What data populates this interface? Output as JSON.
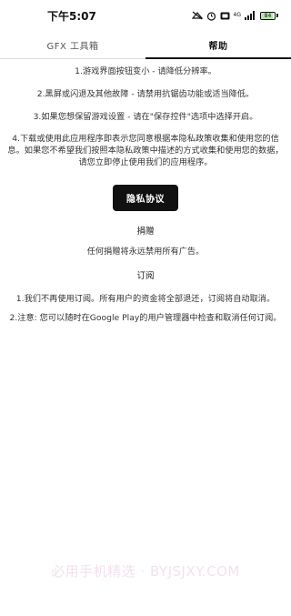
{
  "status_bar": {
    "time": "下午5:07",
    "network_label": "4G",
    "battery_level": "84",
    "icons": [
      "do-not-disturb-icon",
      "alarm-icon",
      "hd-icon",
      "signal-icon",
      "battery-icon"
    ]
  },
  "tabs": [
    {
      "label": "GFX 工具箱",
      "active": false
    },
    {
      "label": "帮助",
      "active": true
    }
  ],
  "help": {
    "p1": "1.游戏界面按钮变小 - 请降低分辨率。",
    "p2": "2.黑屏或闪退及其他故障 - 请禁用抗锯齿功能或适当降低。",
    "p3": "3.如果您想保留游戏设置 - 请在\"保存控件\"选项中选择开启。",
    "p4": "4.下载或使用此应用程序即表示您同意根据本隐私政策收集和使用您的信息。如果您不希望我们按照本隐私政策中描述的方式收集和使用您的数据，请您立即停止使用我们的应用程序。"
  },
  "privacy_button_label": "隐私协议",
  "donation": {
    "title": "捐赠",
    "text": "任何捐赠将永远禁用所有广告。"
  },
  "subscription": {
    "title": "订阅",
    "p1": "1.我们不再使用订阅。所有用户的资金将全部退还，订阅将自动取消。",
    "p2": "2.注意: 您可以随时在Google Play的用户管理器中检查和取消任何订阅。"
  },
  "watermark": "必用手机精选 · BYJSJXY.COM",
  "colors": {
    "accent": "#111111",
    "background": "#ffffff",
    "watermark": "#f2e2ee"
  }
}
